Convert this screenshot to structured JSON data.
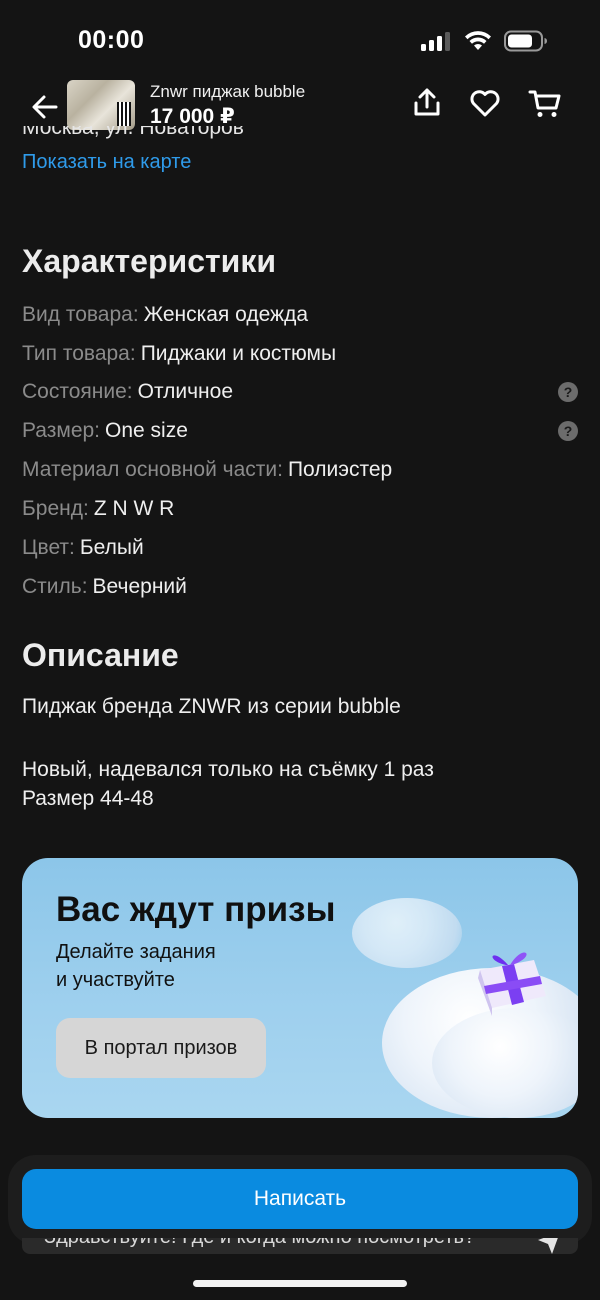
{
  "status": {
    "time": "00:00"
  },
  "header": {
    "title": "Znwr пиджак bubble",
    "price": "17 000 ₽"
  },
  "location": {
    "address": "Москва, ул. Новаторов",
    "map_link": "Показать на карте"
  },
  "characteristics": {
    "title": "Характеристики",
    "rows": [
      {
        "label": "Вид товара:",
        "value": "Женская одежда",
        "help": false
      },
      {
        "label": "Тип товара:",
        "value": "Пиджаки и костюмы",
        "help": false
      },
      {
        "label": "Состояние:",
        "value": "Отличное",
        "help": true
      },
      {
        "label": "Размер:",
        "value": "One size",
        "help": true
      },
      {
        "label": "Материал основной части:",
        "value": "Полиэстер",
        "help": false
      },
      {
        "label": "Бренд:",
        "value": "Z N W R",
        "help": false
      },
      {
        "label": "Цвет:",
        "value": "Белый",
        "help": false
      },
      {
        "label": "Стиль:",
        "value": "Вечерний",
        "help": false
      }
    ],
    "help_glyph": "?"
  },
  "description": {
    "title": "Описание",
    "line1": "Пиджак бренда ZNWR из серии bubble",
    "line2": "Новый, надевался только на съёмку 1 раз",
    "line3": "Размер 44-48"
  },
  "promo": {
    "title": "Вас ждут призы",
    "subtitle_line1": "Делайте задания",
    "subtitle_line2": "и участвуйте",
    "button": "В портал призов"
  },
  "bottom": {
    "write_button": "Написать",
    "quick_message": "Здравствуйте! Где и когда можно посмотреть?"
  },
  "colors": {
    "background": "#141414",
    "link": "#2f9bea",
    "primary_button": "#0a8be0",
    "promo_bg": "#9fd0ee"
  }
}
